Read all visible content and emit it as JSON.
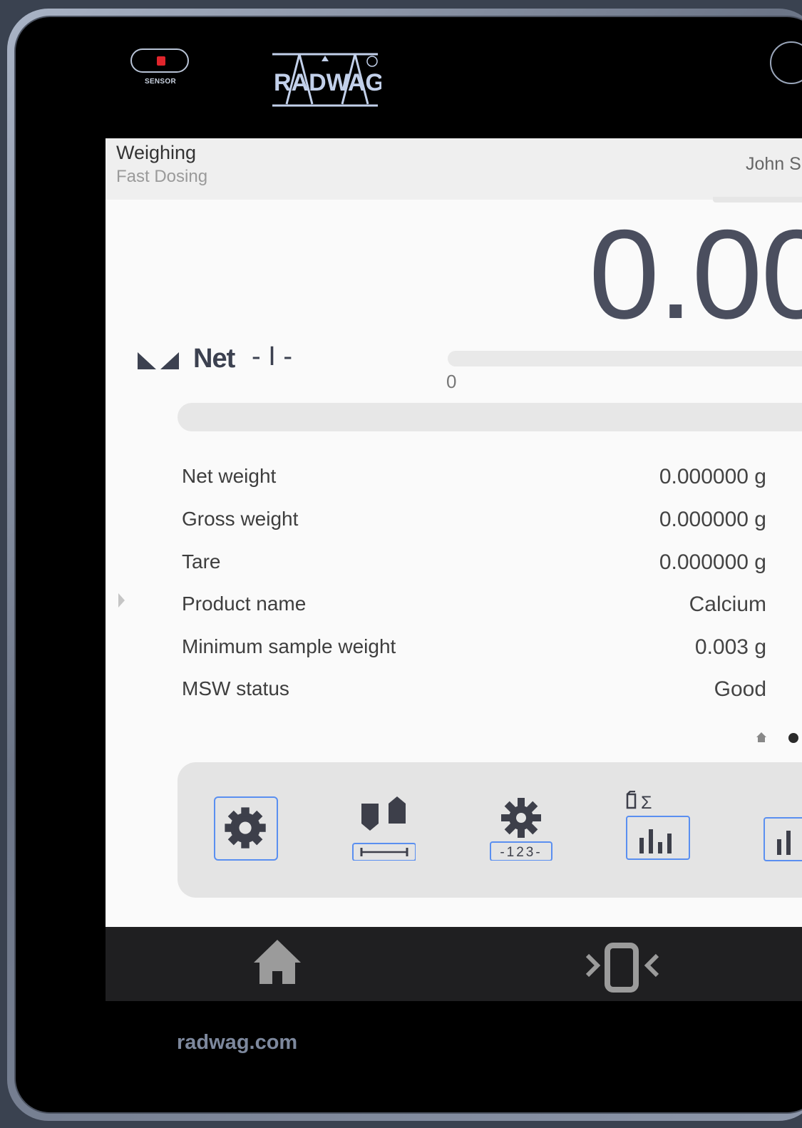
{
  "device": {
    "sensor_label": "SENSOR",
    "brand": "RADWAG",
    "website": "radwag.com"
  },
  "header": {
    "title": "Weighing",
    "subtitle": "Fast Dosing",
    "user": "John S"
  },
  "reading": {
    "value": "0.00",
    "mode_label": "Net",
    "range_label": "- I -",
    "capacity_min": "0",
    "capacity_fraction": 0,
    "progress_fraction": 0
  },
  "info": [
    {
      "label": "Net weight",
      "value": "0.000000 g"
    },
    {
      "label": "Gross weight",
      "value": "0.000000 g"
    },
    {
      "label": "Tare",
      "value": "0.000000 g"
    },
    {
      "label": "Product name",
      "value": "Calcium"
    },
    {
      "label": "Minimum sample weight",
      "value": "0.003 g"
    },
    {
      "label": "MSW status",
      "value": "Good"
    }
  ],
  "toolbar": {
    "buttons": [
      {
        "icon": "settings-icon"
      },
      {
        "icon": "tare-icon"
      },
      {
        "icon": "settings-numeric-icon",
        "label": "-123-"
      },
      {
        "icon": "statistics-sum-icon",
        "top_label": "Σ"
      },
      {
        "icon": "statistics-icon"
      }
    ]
  },
  "colors": {
    "accent": "#5a8ff0",
    "screen_bg": "#fafafa",
    "bezel": "#000000"
  }
}
